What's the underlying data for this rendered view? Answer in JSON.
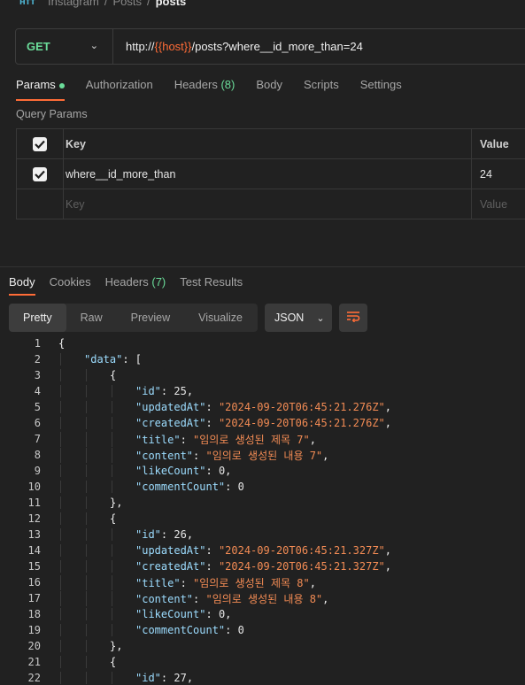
{
  "breadcrumb": {
    "icon": "http-icon",
    "items": [
      "Instagram",
      "Posts",
      "posts"
    ],
    "separator": "/"
  },
  "request": {
    "method": "GET",
    "url_prefix": "http://",
    "url_var": "{{host}}",
    "url_rest": "/posts?where__id_more_than=24"
  },
  "request_tabs": [
    {
      "label": "Params",
      "active": true,
      "indicator": "dot"
    },
    {
      "label": "Authorization"
    },
    {
      "label": "Headers",
      "count": "(8)"
    },
    {
      "label": "Body"
    },
    {
      "label": "Scripts"
    },
    {
      "label": "Settings"
    }
  ],
  "query_params": {
    "title": "Query Params",
    "header": {
      "key": "Key",
      "value": "Value"
    },
    "rows": [
      {
        "key": "where__id_more_than",
        "value": "24",
        "checked": true
      }
    ],
    "placeholder": {
      "key": "Key",
      "value": "Value"
    }
  },
  "response_tabs": [
    {
      "label": "Body",
      "active": true
    },
    {
      "label": "Cookies"
    },
    {
      "label": "Headers",
      "count": "(7)"
    },
    {
      "label": "Test Results"
    }
  ],
  "view_modes": [
    "Pretty",
    "Raw",
    "Preview",
    "Visualize"
  ],
  "active_view": "Pretty",
  "format": "JSON",
  "code_lines": [
    {
      "n": 1,
      "indent": 0,
      "tokens": [
        [
          "p",
          "{"
        ]
      ]
    },
    {
      "n": 2,
      "indent": 1,
      "tokens": [
        [
          "k",
          "\"data\""
        ],
        [
          "p",
          ": ["
        ]
      ]
    },
    {
      "n": 3,
      "indent": 2,
      "tokens": [
        [
          "p",
          "{"
        ]
      ]
    },
    {
      "n": 4,
      "indent": 3,
      "tokens": [
        [
          "k",
          "\"id\""
        ],
        [
          "p",
          ": "
        ],
        [
          "n",
          "25"
        ],
        [
          "p",
          ","
        ]
      ]
    },
    {
      "n": 5,
      "indent": 3,
      "tokens": [
        [
          "k",
          "\"updatedAt\""
        ],
        [
          "p",
          ": "
        ],
        [
          "s",
          "\"2024-09-20T06:45:21.276Z\""
        ],
        [
          "p",
          ","
        ]
      ]
    },
    {
      "n": 6,
      "indent": 3,
      "tokens": [
        [
          "k",
          "\"createdAt\""
        ],
        [
          "p",
          ": "
        ],
        [
          "s",
          "\"2024-09-20T06:45:21.276Z\""
        ],
        [
          "p",
          ","
        ]
      ]
    },
    {
      "n": 7,
      "indent": 3,
      "tokens": [
        [
          "k",
          "\"title\""
        ],
        [
          "p",
          ": "
        ],
        [
          "s",
          "\"임의로 생성된 제목 7\""
        ],
        [
          "p",
          ","
        ]
      ]
    },
    {
      "n": 8,
      "indent": 3,
      "tokens": [
        [
          "k",
          "\"content\""
        ],
        [
          "p",
          ": "
        ],
        [
          "s",
          "\"임의로 생성된 내용 7\""
        ],
        [
          "p",
          ","
        ]
      ]
    },
    {
      "n": 9,
      "indent": 3,
      "tokens": [
        [
          "k",
          "\"likeCount\""
        ],
        [
          "p",
          ": "
        ],
        [
          "n",
          "0"
        ],
        [
          "p",
          ","
        ]
      ]
    },
    {
      "n": 10,
      "indent": 3,
      "tokens": [
        [
          "k",
          "\"commentCount\""
        ],
        [
          "p",
          ": "
        ],
        [
          "n",
          "0"
        ]
      ]
    },
    {
      "n": 11,
      "indent": 2,
      "tokens": [
        [
          "p",
          "},"
        ]
      ]
    },
    {
      "n": 12,
      "indent": 2,
      "tokens": [
        [
          "p",
          "{"
        ]
      ]
    },
    {
      "n": 13,
      "indent": 3,
      "tokens": [
        [
          "k",
          "\"id\""
        ],
        [
          "p",
          ": "
        ],
        [
          "n",
          "26"
        ],
        [
          "p",
          ","
        ]
      ]
    },
    {
      "n": 14,
      "indent": 3,
      "tokens": [
        [
          "k",
          "\"updatedAt\""
        ],
        [
          "p",
          ": "
        ],
        [
          "s",
          "\"2024-09-20T06:45:21.327Z\""
        ],
        [
          "p",
          ","
        ]
      ]
    },
    {
      "n": 15,
      "indent": 3,
      "tokens": [
        [
          "k",
          "\"createdAt\""
        ],
        [
          "p",
          ": "
        ],
        [
          "s",
          "\"2024-09-20T06:45:21.327Z\""
        ],
        [
          "p",
          ","
        ]
      ]
    },
    {
      "n": 16,
      "indent": 3,
      "tokens": [
        [
          "k",
          "\"title\""
        ],
        [
          "p",
          ": "
        ],
        [
          "s",
          "\"임의로 생성된 제목 8\""
        ],
        [
          "p",
          ","
        ]
      ]
    },
    {
      "n": 17,
      "indent": 3,
      "tokens": [
        [
          "k",
          "\"content\""
        ],
        [
          "p",
          ": "
        ],
        [
          "s",
          "\"임의로 생성된 내용 8\""
        ],
        [
          "p",
          ","
        ]
      ]
    },
    {
      "n": 18,
      "indent": 3,
      "tokens": [
        [
          "k",
          "\"likeCount\""
        ],
        [
          "p",
          ": "
        ],
        [
          "n",
          "0"
        ],
        [
          "p",
          ","
        ]
      ]
    },
    {
      "n": 19,
      "indent": 3,
      "tokens": [
        [
          "k",
          "\"commentCount\""
        ],
        [
          "p",
          ": "
        ],
        [
          "n",
          "0"
        ]
      ]
    },
    {
      "n": 20,
      "indent": 2,
      "tokens": [
        [
          "p",
          "},"
        ]
      ]
    },
    {
      "n": 21,
      "indent": 2,
      "tokens": [
        [
          "p",
          "{"
        ]
      ]
    },
    {
      "n": 22,
      "indent": 3,
      "tokens": [
        [
          "k",
          "\"id\""
        ],
        [
          "p",
          ": "
        ],
        [
          "n",
          "27"
        ],
        [
          "p",
          ","
        ]
      ]
    }
  ],
  "colors": {
    "accent": "#ff6c37",
    "method_get": "#6bdd9a",
    "json_key": "#9cdcfe",
    "json_string": "#f28b54"
  }
}
